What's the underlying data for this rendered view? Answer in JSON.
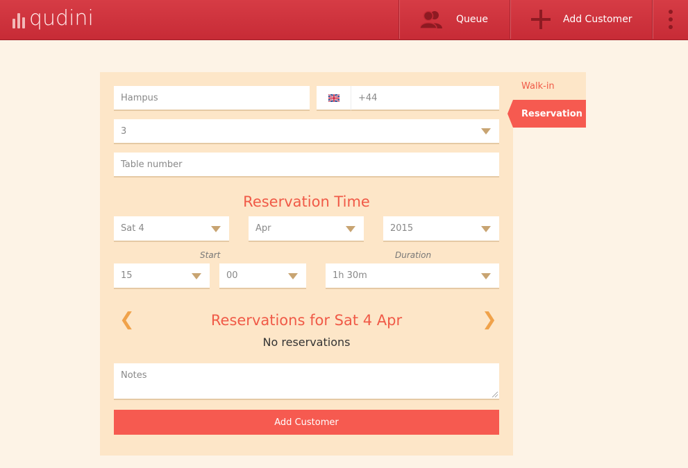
{
  "header": {
    "logo_text": "qudini",
    "queue_label": "Queue",
    "add_customer_label": "Add Customer",
    "brand_color": "#c72b36"
  },
  "form": {
    "name_value": "Hampus",
    "phone_prefix": "+44",
    "party_size": "3",
    "table_number_placeholder": "Table number",
    "reservation_time_title": "Reservation Time",
    "day": "Sat 4",
    "month": "Apr",
    "year": "2015",
    "start_label": "Start",
    "duration_label": "Duration",
    "start_hour": "15",
    "start_minute": "00",
    "duration": "1h 30m",
    "reservations_title": "Reservations for Sat 4 Apr",
    "prev_arrow": "❮",
    "next_arrow": "❯",
    "no_reservations": "No reservations",
    "notes_placeholder": "Notes",
    "submit_label": "Add Customer",
    "accent_color": "#f65a50"
  },
  "tabs": {
    "walkin_label": "Walk-in",
    "reservation_label": "Reservation"
  }
}
